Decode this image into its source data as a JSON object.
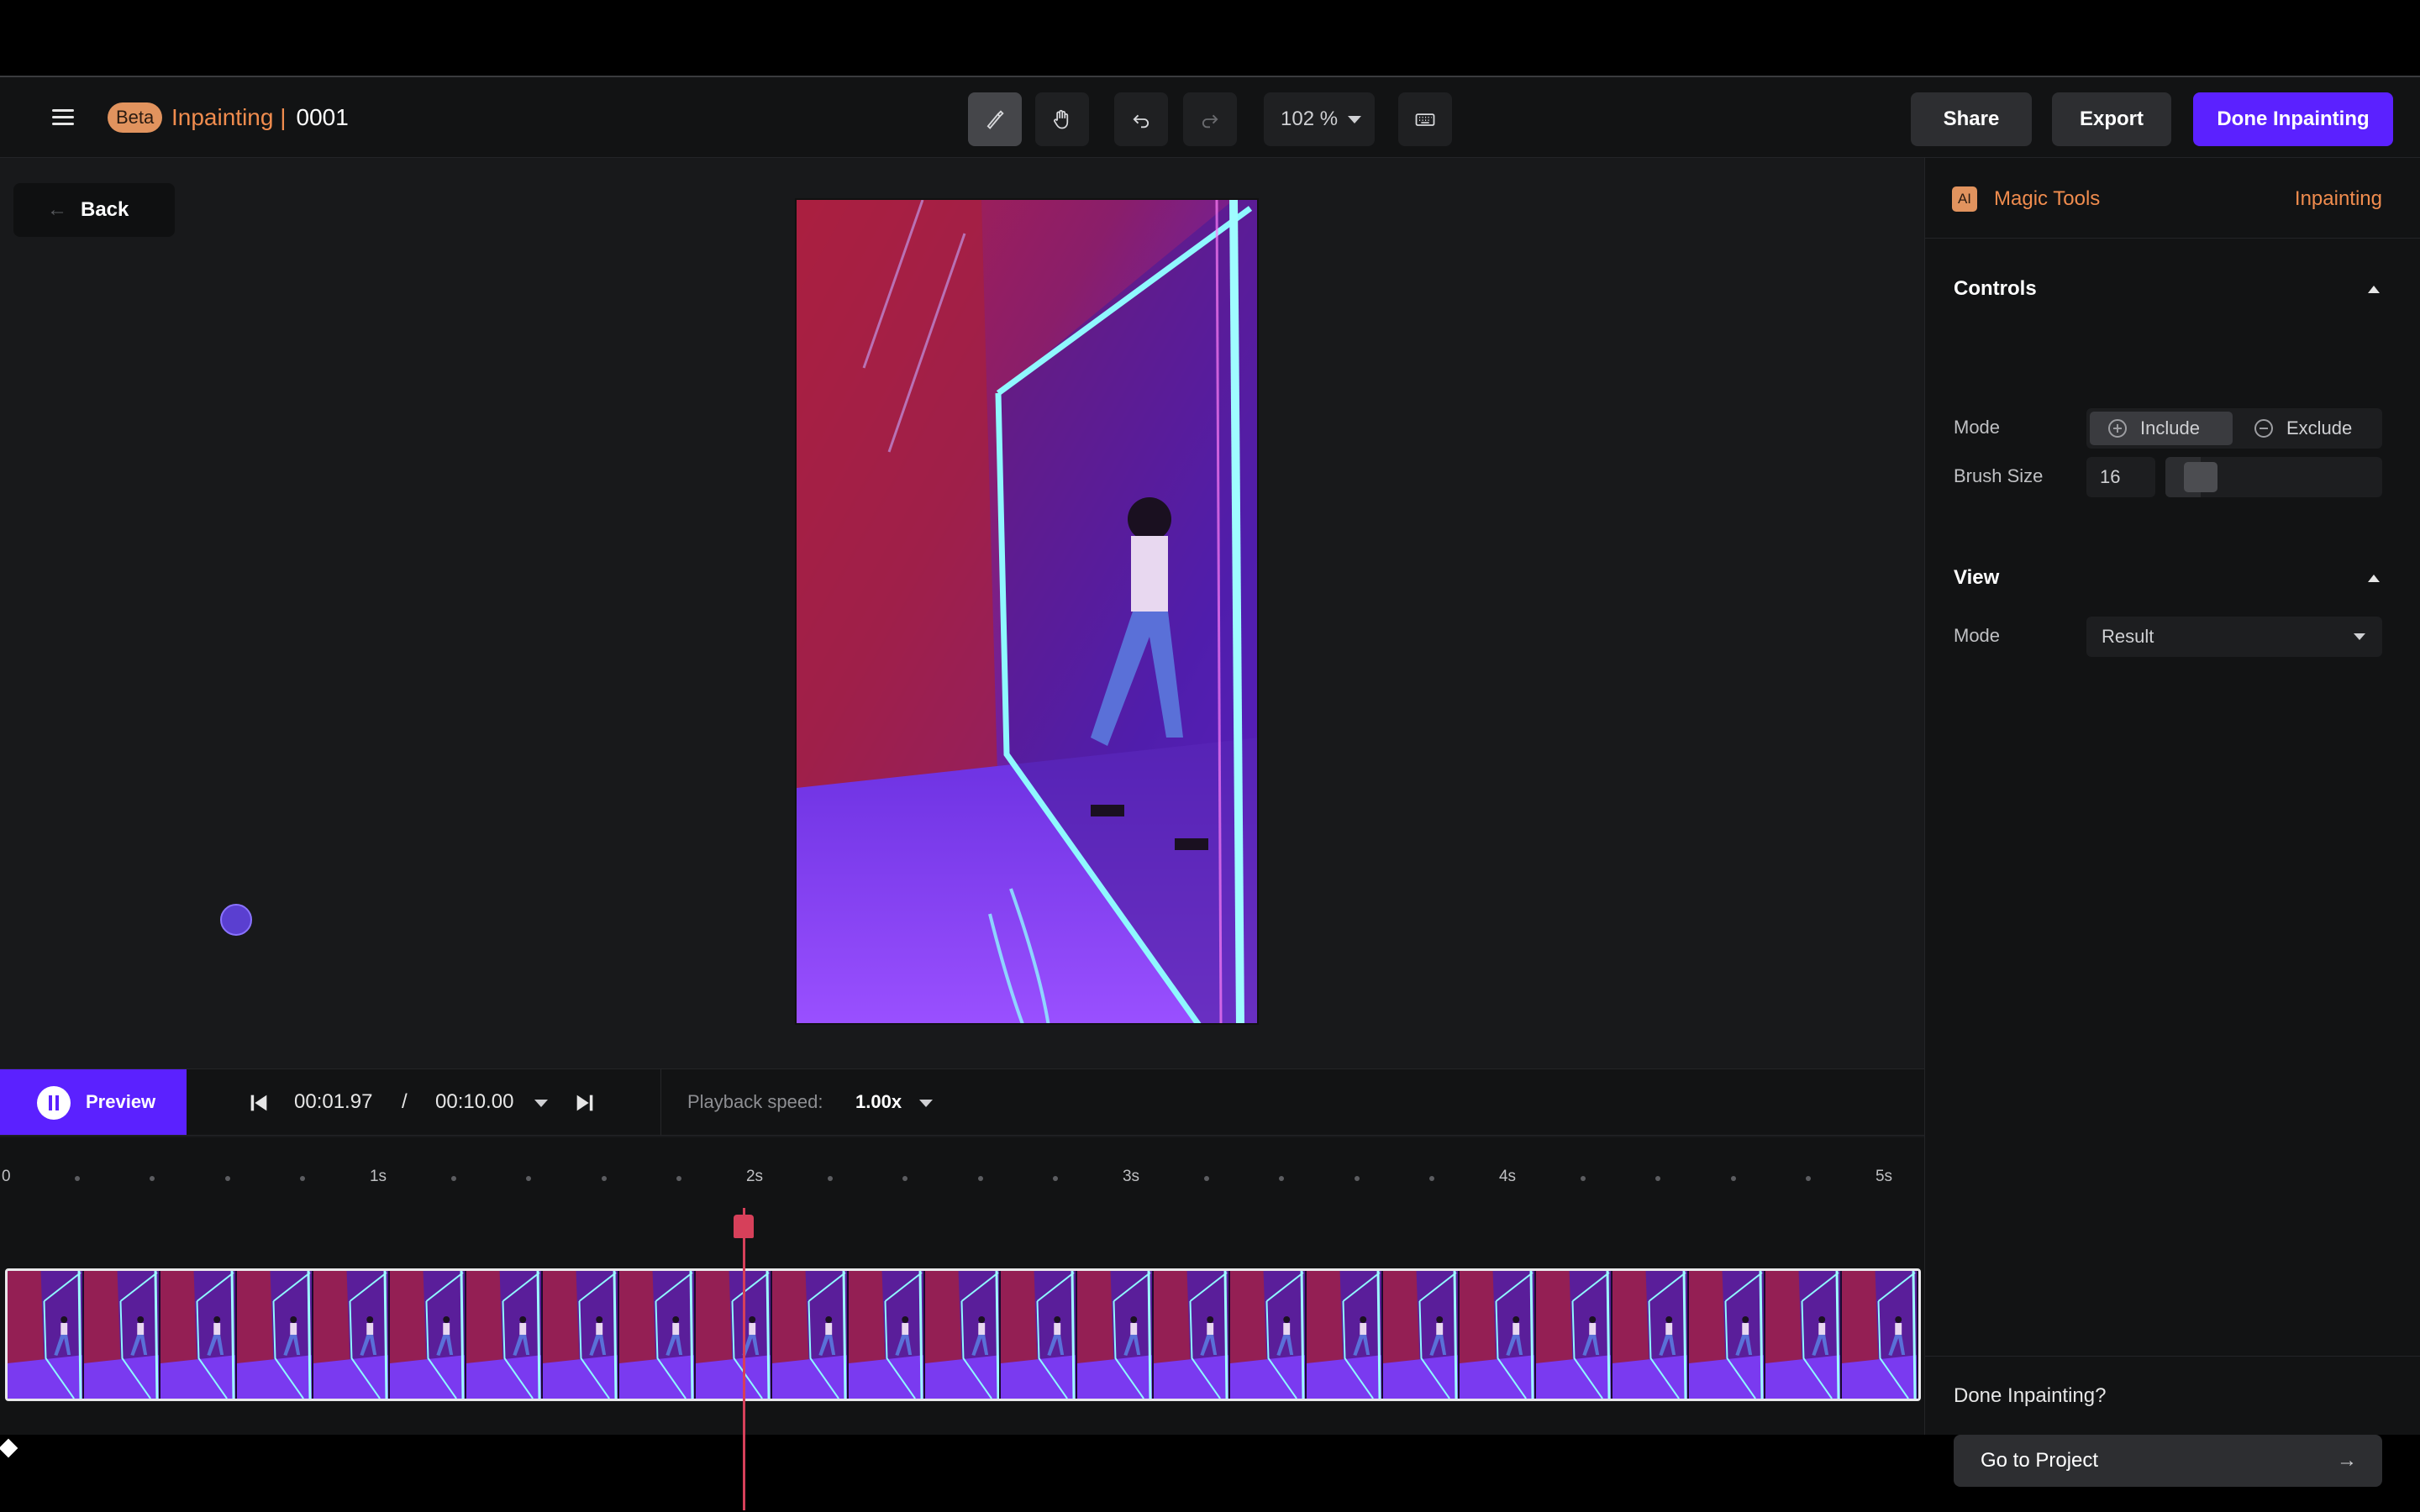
{
  "header": {
    "beta": "Beta",
    "app_name": "Inpainting |",
    "project": "0001",
    "zoom": "102 %",
    "share": "Share",
    "export": "Export",
    "done": "Done Inpainting",
    "tools": [
      "brush-icon",
      "hand-icon",
      "undo-icon",
      "redo-icon",
      "keyboard-icon"
    ]
  },
  "canvas": {
    "back": "Back",
    "back_icon": "arrow-left-icon"
  },
  "panel": {
    "ai_badge": "AI",
    "title": "Magic Tools",
    "tool_name": "Inpainting",
    "controls": {
      "heading": "Controls",
      "mode_label": "Mode",
      "include": "Include",
      "exclude": "Exclude",
      "selected_mode": "Include",
      "brush_label": "Brush Size",
      "brush_size": "16",
      "brush_slider_fraction": 0.1
    },
    "view": {
      "heading": "View",
      "mode_label": "Mode",
      "mode_value": "Result"
    },
    "footer": {
      "question": "Done Inpainting?",
      "go": "Go to Project",
      "go_icon": "arrow-right-icon"
    }
  },
  "timeline": {
    "preview": "Preview",
    "current_time": "00:01.97",
    "separator": "/",
    "total_time": "00:10.00",
    "playback_label": "Playback speed:",
    "playback_speed": "1.00x",
    "ruler_labels": [
      "0",
      "1s",
      "2s",
      "3s",
      "4s",
      "5s"
    ],
    "frame_count": 25,
    "playhead_seconds": 1.97
  },
  "colors": {
    "accent": "#5b21ff",
    "brand_orange": "#f08c4e",
    "playhead": "#d6405a"
  }
}
